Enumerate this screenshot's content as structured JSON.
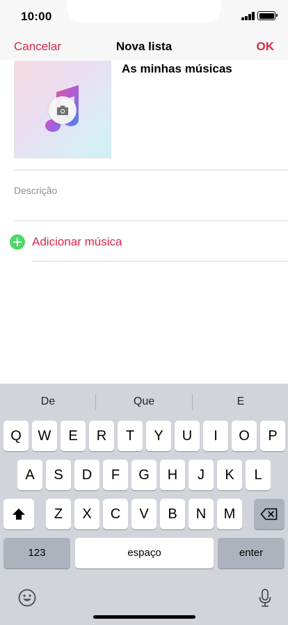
{
  "status": {
    "time": "10:00"
  },
  "nav": {
    "cancel": "Cancelar",
    "title": "Nova lista",
    "ok": "OK"
  },
  "playlist": {
    "title": "As minhas músicas",
    "description_placeholder": "Descrição",
    "add_music_label": "Adicionar música"
  },
  "colors": {
    "accent": "#d7274a",
    "add_green": "#4cd964",
    "keyboard_bg": "#d1d4db"
  },
  "keyboard": {
    "suggestions": [
      "De",
      "Que",
      "E"
    ],
    "row1": [
      "Q",
      "W",
      "E",
      "R",
      "T",
      "Y",
      "U",
      "I",
      "O",
      "P"
    ],
    "row2": [
      "A",
      "S",
      "D",
      "F",
      "G",
      "H",
      "J",
      "K",
      "L"
    ],
    "row3": [
      "Z",
      "X",
      "C",
      "V",
      "B",
      "N",
      "M"
    ],
    "numbers_key": "123",
    "space_key": "espaço",
    "return_key": "enter",
    "icons": [
      "shift-icon",
      "backspace-icon",
      "emoji-icon",
      "microphone-icon"
    ]
  }
}
